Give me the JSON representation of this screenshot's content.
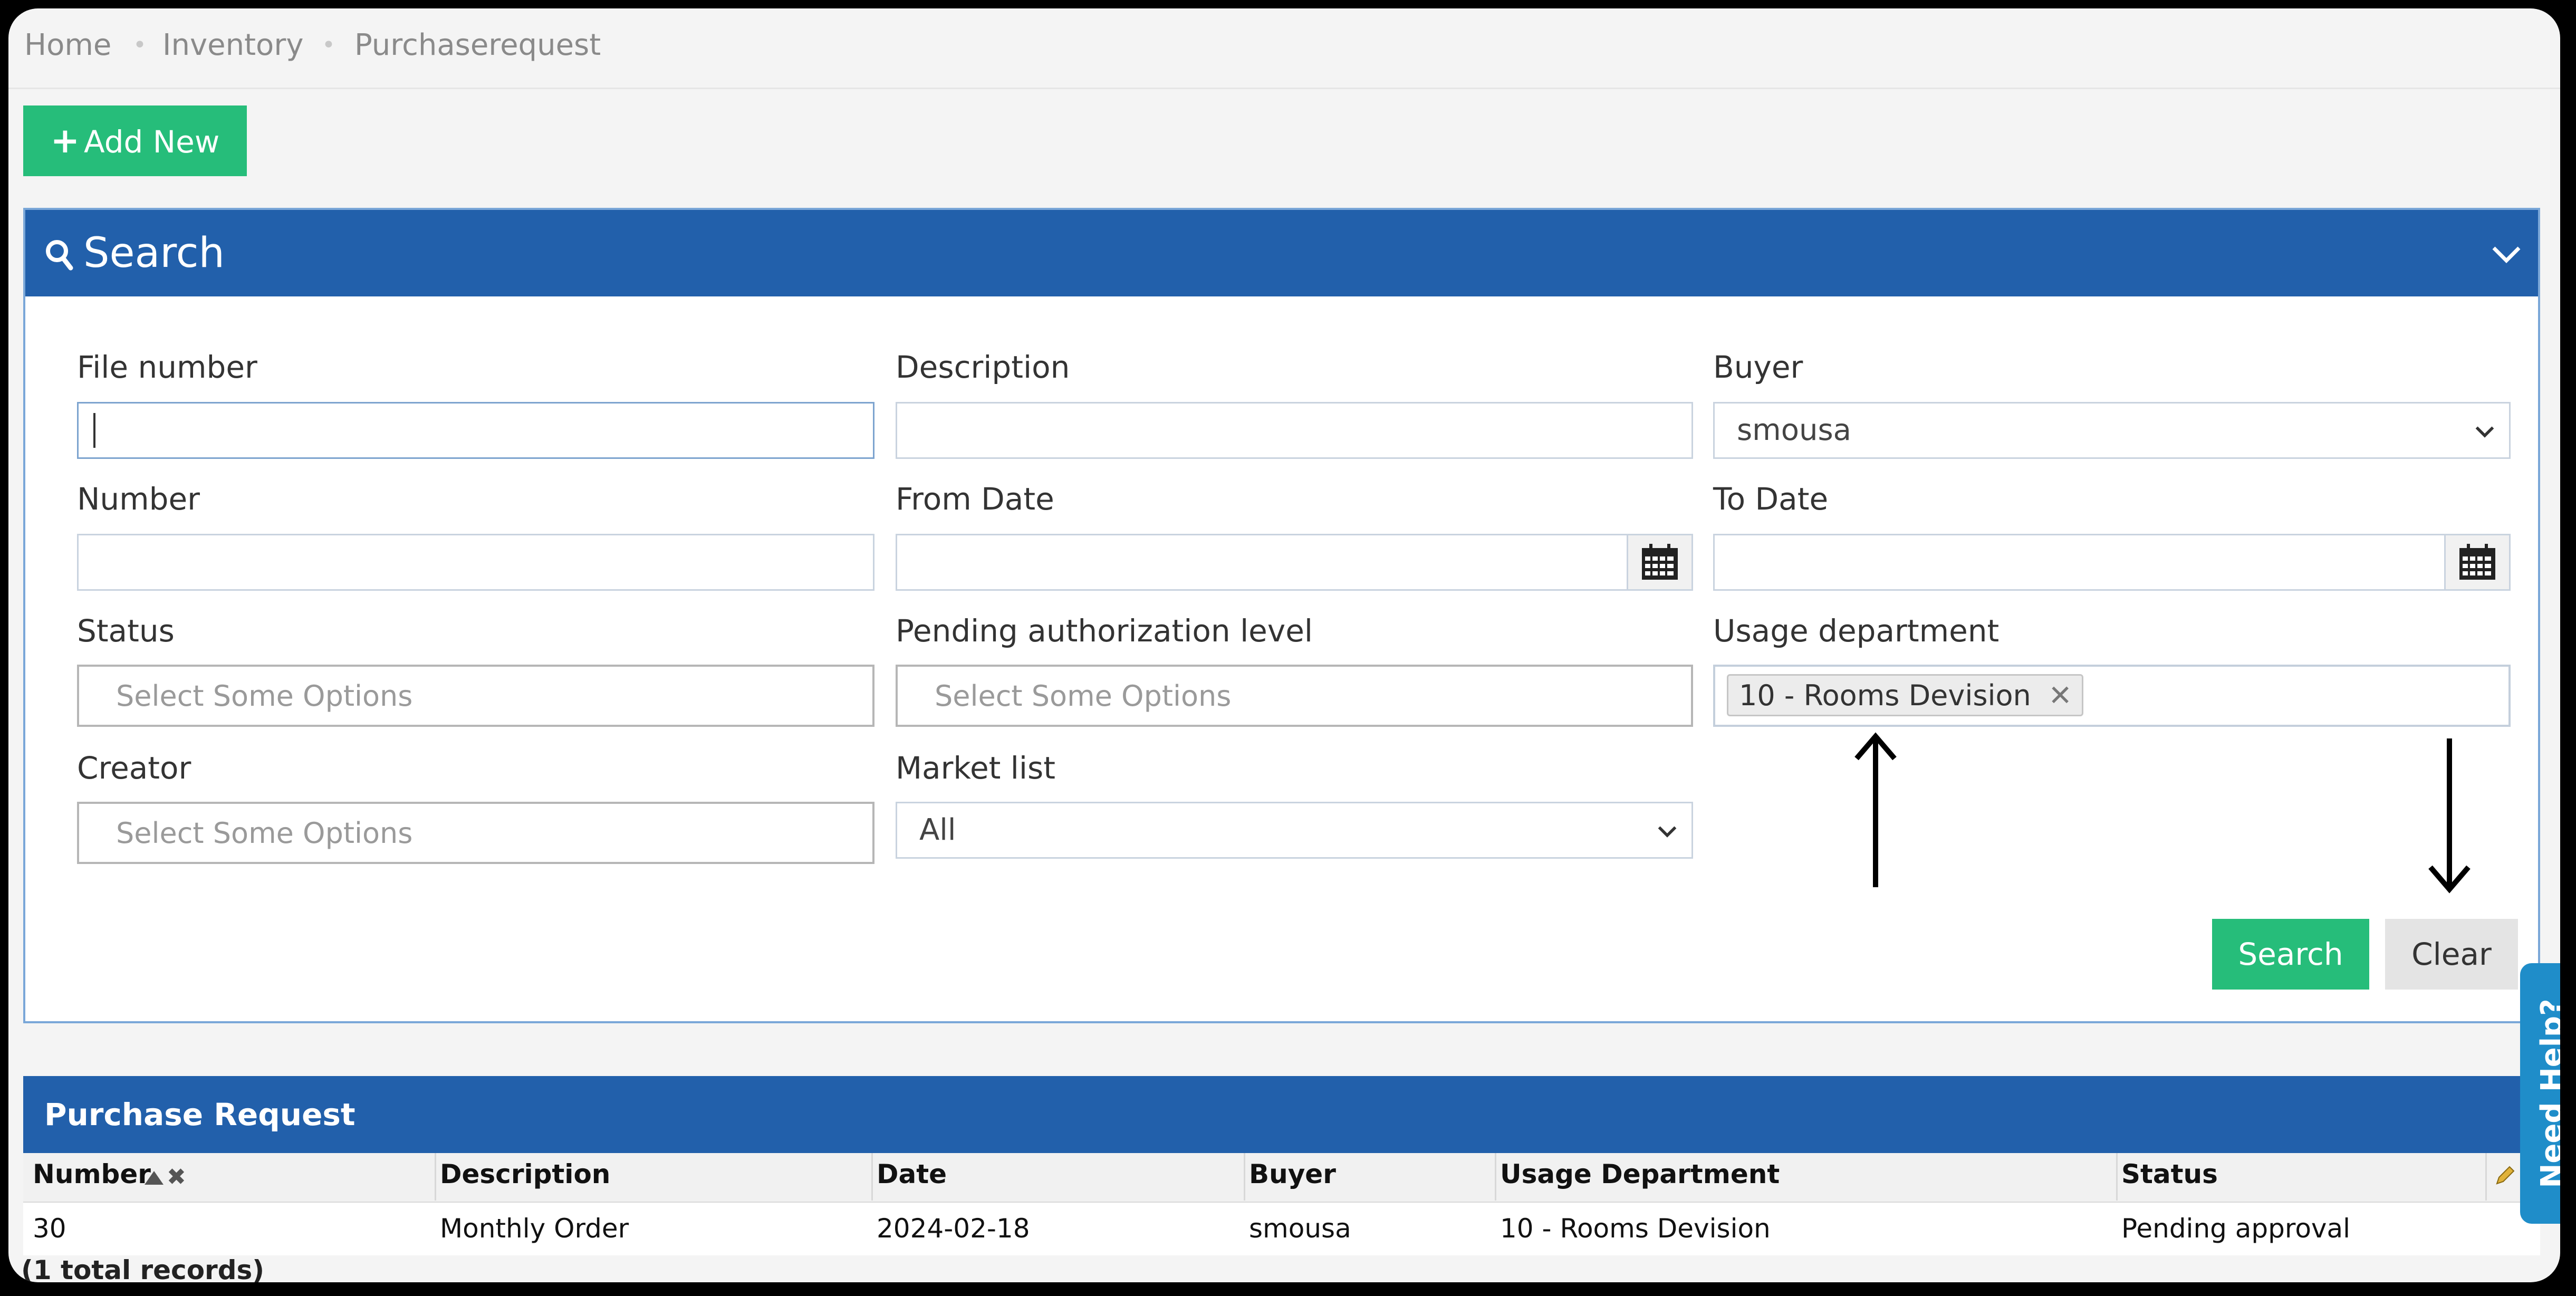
{
  "breadcrumb": [
    "Home",
    "Inventory",
    "Purchaserequest"
  ],
  "toolbar": {
    "add_new_label": "Add New"
  },
  "search_panel": {
    "title": "Search",
    "fields": {
      "file_number": {
        "label": "File number",
        "value": ""
      },
      "description": {
        "label": "Description",
        "value": ""
      },
      "buyer": {
        "label": "Buyer",
        "value": "smousa"
      },
      "number": {
        "label": "Number",
        "value": ""
      },
      "from_date": {
        "label": "From Date",
        "value": ""
      },
      "to_date": {
        "label": "To Date",
        "value": ""
      },
      "status": {
        "label": "Status",
        "placeholder": "Select Some Options"
      },
      "pending_authorization_level": {
        "label": "Pending authorization level",
        "placeholder": "Select Some Options"
      },
      "usage_department": {
        "label": "Usage department",
        "selected": [
          "10 - Rooms Devision"
        ]
      },
      "creator": {
        "label": "Creator",
        "placeholder": "Select Some Options"
      },
      "market_list": {
        "label": "Market list",
        "value": "All"
      }
    },
    "search_label": "Search",
    "clear_label": "Clear"
  },
  "results": {
    "title": "Purchase Request",
    "columns": [
      "Number",
      "Description",
      "Date",
      "Buyer",
      "Usage Department",
      "Status"
    ],
    "rows": [
      {
        "number": "30",
        "description": "Monthly Order",
        "date": "2024-02-18",
        "buyer": "smousa",
        "usage_department": "10 - Rooms Devision",
        "status": "Pending approval"
      }
    ],
    "total_records": "(1 total records)"
  },
  "help_tab": {
    "label": "Need Help?"
  },
  "icons": [
    "search-icon",
    "chevron-down-icon",
    "calendar-icon",
    "sort-asc-icon",
    "remove-sort-icon",
    "close-icon",
    "plus-icon",
    "edit-icon"
  ],
  "colors": {
    "header_blue": "#2260ab",
    "action_green": "#26bd7a",
    "help_blue": "#1f8dc9"
  }
}
